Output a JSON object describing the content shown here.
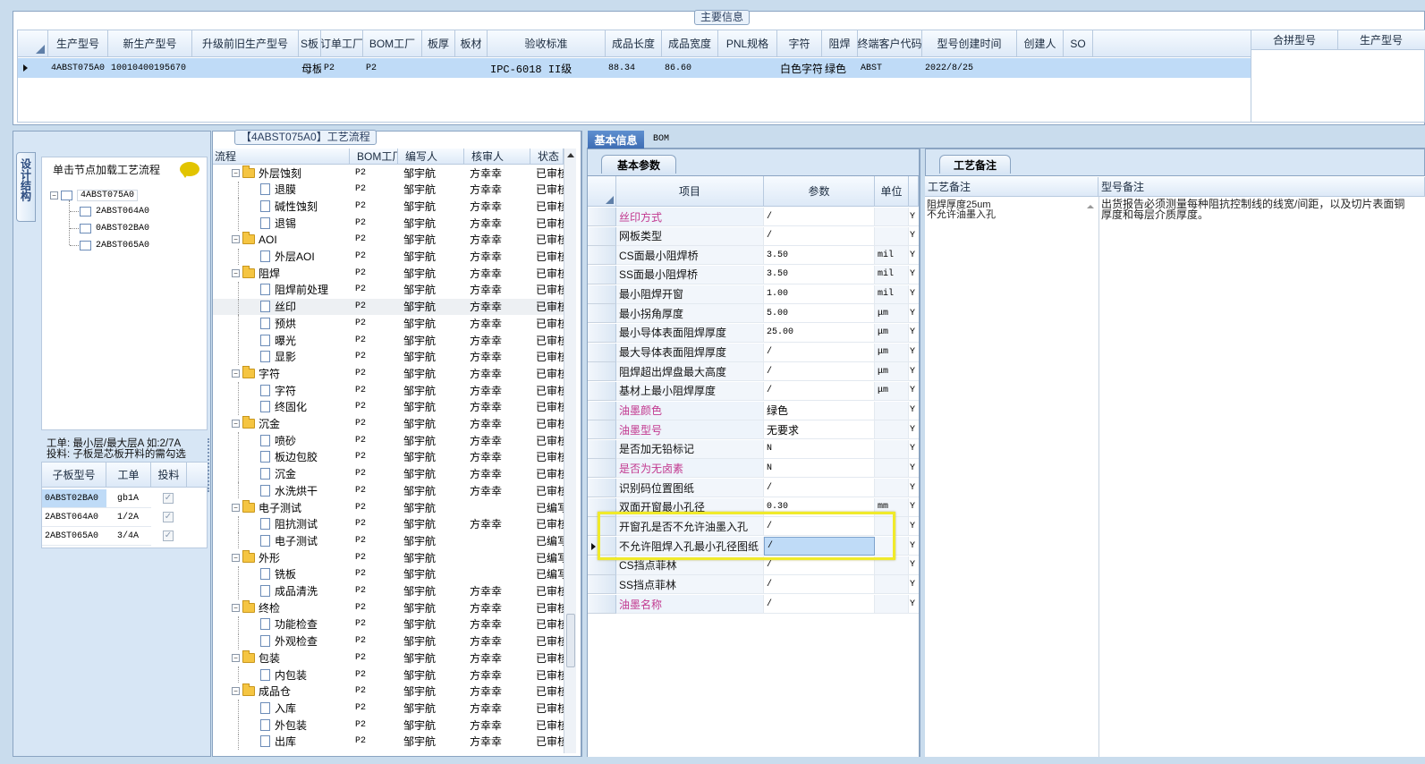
{
  "top": {
    "group_title": "主要信息",
    "columns": [
      "生产型号",
      "新生产型号",
      "升级前旧生产型号",
      "S板",
      "订单工厂",
      "BOM工厂",
      "板厚",
      "板材",
      "验收标准",
      "成品长度",
      "成品宽度",
      "PNL规格",
      "字符",
      "阻焊",
      "终端客户代码",
      "型号创建时间",
      "创建人",
      "SO"
    ],
    "row": [
      "4ABST075A0",
      "10010400195670",
      "",
      "母板",
      "P2",
      "P2",
      "",
      "",
      "IPC-6018 II级",
      "88.34",
      "86.60",
      "",
      "白色字符",
      "绿色",
      "ABST",
      "2022/8/25",
      "",
      ""
    ],
    "right_columns": [
      "合拼型号",
      "生产型号"
    ]
  },
  "left": {
    "vertical_tab": "设计结构",
    "hint": "单击节点加载工艺流程",
    "tree_root": "4ABST075A0",
    "tree_children": [
      "2ABST064A0",
      "0ABST02BA0",
      "2ABST065A0"
    ],
    "note_line1": "工单: 最小层/最大层A 如:2/7A",
    "note_line2": "投料: 子板是芯板开料的需勾选",
    "sub_columns": [
      "子板型号",
      "工单",
      "投料"
    ],
    "sub_rows": [
      {
        "model": "0ABST02BA0",
        "order": "gb1A",
        "check": "✓"
      },
      {
        "model": "2ABST064A0",
        "order": "1/2A",
        "check": "✓"
      },
      {
        "model": "2ABST065A0",
        "order": "3/4A",
        "check": "✓"
      }
    ]
  },
  "flow": {
    "title": "【4ABST075A0】工艺流程",
    "columns": [
      "流程",
      "BOM工厂",
      "编写人",
      "核审人",
      "状态"
    ],
    "rows": [
      {
        "name": "外层蚀刻",
        "folder": true,
        "bom": "P2",
        "writer": "邹宇航",
        "reviewer": "方幸幸",
        "status": "已审核"
      },
      {
        "name": "退膜",
        "folder": false,
        "bom": "P2",
        "writer": "邹宇航",
        "reviewer": "方幸幸",
        "status": "已审核"
      },
      {
        "name": "碱性蚀刻",
        "folder": false,
        "bom": "P2",
        "writer": "邹宇航",
        "reviewer": "方幸幸",
        "status": "已审核"
      },
      {
        "name": "退锡",
        "folder": false,
        "bom": "P2",
        "writer": "邹宇航",
        "reviewer": "方幸幸",
        "status": "已审核"
      },
      {
        "name": "AOI",
        "folder": true,
        "bom": "P2",
        "writer": "邹宇航",
        "reviewer": "方幸幸",
        "status": "已审核"
      },
      {
        "name": "外层AOI",
        "folder": false,
        "bom": "P2",
        "writer": "邹宇航",
        "reviewer": "方幸幸",
        "status": "已审核"
      },
      {
        "name": "阻焊",
        "folder": true,
        "bom": "P2",
        "writer": "邹宇航",
        "reviewer": "方幸幸",
        "status": "已审核"
      },
      {
        "name": "阻焊前处理",
        "folder": false,
        "bom": "P2",
        "writer": "邹宇航",
        "reviewer": "方幸幸",
        "status": "已审核"
      },
      {
        "name": "丝印",
        "folder": false,
        "bom": "P2",
        "writer": "邹宇航",
        "reviewer": "方幸幸",
        "status": "已审核"
      },
      {
        "name": "预烘",
        "folder": false,
        "bom": "P2",
        "writer": "邹宇航",
        "reviewer": "方幸幸",
        "status": "已审核"
      },
      {
        "name": "曝光",
        "folder": false,
        "bom": "P2",
        "writer": "邹宇航",
        "reviewer": "方幸幸",
        "status": "已审核"
      },
      {
        "name": "显影",
        "folder": false,
        "bom": "P2",
        "writer": "邹宇航",
        "reviewer": "方幸幸",
        "status": "已审核"
      },
      {
        "name": "字符",
        "folder": true,
        "bom": "P2",
        "writer": "邹宇航",
        "reviewer": "方幸幸",
        "status": "已审核"
      },
      {
        "name": "字符",
        "folder": false,
        "bom": "P2",
        "writer": "邹宇航",
        "reviewer": "方幸幸",
        "status": "已审核"
      },
      {
        "name": "终固化",
        "folder": false,
        "bom": "P2",
        "writer": "邹宇航",
        "reviewer": "方幸幸",
        "status": "已审核"
      },
      {
        "name": "沉金",
        "folder": true,
        "bom": "P2",
        "writer": "邹宇航",
        "reviewer": "方幸幸",
        "status": "已审核"
      },
      {
        "name": "喷砂",
        "folder": false,
        "bom": "P2",
        "writer": "邹宇航",
        "reviewer": "方幸幸",
        "status": "已审核"
      },
      {
        "name": "板边包胶",
        "folder": false,
        "bom": "P2",
        "writer": "邹宇航",
        "reviewer": "方幸幸",
        "status": "已审核"
      },
      {
        "name": "沉金",
        "folder": false,
        "bom": "P2",
        "writer": "邹宇航",
        "reviewer": "方幸幸",
        "status": "已审核"
      },
      {
        "name": "水洗烘干",
        "folder": false,
        "bom": "P2",
        "writer": "邹宇航",
        "reviewer": "方幸幸",
        "status": "已审核"
      },
      {
        "name": "电子测试",
        "folder": true,
        "bom": "P2",
        "writer": "邹宇航",
        "reviewer": "",
        "status": "已编写"
      },
      {
        "name": "阻抗测试",
        "folder": false,
        "bom": "P2",
        "writer": "邹宇航",
        "reviewer": "方幸幸",
        "status": "已审核"
      },
      {
        "name": "电子测试",
        "folder": false,
        "bom": "P2",
        "writer": "邹宇航",
        "reviewer": "",
        "status": "已编写"
      },
      {
        "name": "外形",
        "folder": true,
        "bom": "P2",
        "writer": "邹宇航",
        "reviewer": "",
        "status": "已编写"
      },
      {
        "name": "铣板",
        "folder": false,
        "bom": "P2",
        "writer": "邹宇航",
        "reviewer": "",
        "status": "已编写"
      },
      {
        "name": "成品清洗",
        "folder": false,
        "bom": "P2",
        "writer": "邹宇航",
        "reviewer": "方幸幸",
        "status": "已审核"
      },
      {
        "name": "终检",
        "folder": true,
        "bom": "P2",
        "writer": "邹宇航",
        "reviewer": "方幸幸",
        "status": "已审核"
      },
      {
        "name": "功能检查",
        "folder": false,
        "bom": "P2",
        "writer": "邹宇航",
        "reviewer": "方幸幸",
        "status": "已审核"
      },
      {
        "name": "外观检查",
        "folder": false,
        "bom": "P2",
        "writer": "邹宇航",
        "reviewer": "方幸幸",
        "status": "已审核"
      },
      {
        "name": "包装",
        "folder": true,
        "bom": "P2",
        "writer": "邹宇航",
        "reviewer": "方幸幸",
        "status": "已审核"
      },
      {
        "name": "内包装",
        "folder": false,
        "bom": "P2",
        "writer": "邹宇航",
        "reviewer": "方幸幸",
        "status": "已审核"
      },
      {
        "name": "成品仓",
        "folder": true,
        "bom": "P2",
        "writer": "邹宇航",
        "reviewer": "方幸幸",
        "status": "已审核"
      },
      {
        "name": "入库",
        "folder": false,
        "bom": "P2",
        "writer": "邹宇航",
        "reviewer": "方幸幸",
        "status": "已审核"
      },
      {
        "name": "外包装",
        "folder": false,
        "bom": "P2",
        "writer": "邹宇航",
        "reviewer": "方幸幸",
        "status": "已审核"
      },
      {
        "name": "出库",
        "folder": false,
        "bom": "P2",
        "writer": "邹宇航",
        "reviewer": "方幸幸",
        "status": "已审核"
      }
    ]
  },
  "info": {
    "tabs": [
      "基本信息",
      "BOM"
    ],
    "subtab": "基本参数",
    "columns": [
      "项目",
      "参数",
      "单位"
    ],
    "rows": [
      {
        "item": "丝印方式",
        "pink": true,
        "param": "/",
        "unit": "",
        "flag": "Y"
      },
      {
        "item": "网板类型",
        "pink": false,
        "param": "/",
        "unit": "",
        "flag": "Y"
      },
      {
        "item": "CS面最小阻焊桥",
        "pink": false,
        "param": "3.50",
        "unit": "mil",
        "flag": "Y"
      },
      {
        "item": "SS面最小阻焊桥",
        "pink": false,
        "param": "3.50",
        "unit": "mil",
        "flag": "Y"
      },
      {
        "item": "最小阻焊开窗",
        "pink": false,
        "param": "1.00",
        "unit": "mil",
        "flag": "Y"
      },
      {
        "item": "最小拐角厚度",
        "pink": false,
        "param": "5.00",
        "unit": "μm",
        "flag": "Y"
      },
      {
        "item": "最小导体表面阻焊厚度",
        "pink": false,
        "param": "25.00",
        "unit": "μm",
        "flag": "Y"
      },
      {
        "item": "最大导体表面阻焊厚度",
        "pink": false,
        "param": "/",
        "unit": "μm",
        "flag": "Y"
      },
      {
        "item": "阻焊超出焊盘最大高度",
        "pink": false,
        "param": "/",
        "unit": "μm",
        "flag": "Y"
      },
      {
        "item": "基材上最小阻焊厚度",
        "pink": false,
        "param": "/",
        "unit": "μm",
        "flag": "Y"
      },
      {
        "item": "油墨颜色",
        "pink": true,
        "param": "绿色",
        "unit": "",
        "flag": "Y"
      },
      {
        "item": "油墨型号",
        "pink": true,
        "param": "无要求",
        "unit": "",
        "flag": "Y"
      },
      {
        "item": "是否加无铅标记",
        "pink": false,
        "param": "N",
        "unit": "",
        "flag": "Y"
      },
      {
        "item": "是否为无卤素",
        "pink": true,
        "param": "N",
        "unit": "",
        "flag": "Y"
      },
      {
        "item": "识别码位置图纸",
        "pink": false,
        "param": "/",
        "unit": "",
        "flag": "Y"
      },
      {
        "item": "双面开窗最小孔径",
        "pink": false,
        "param": "0.30",
        "unit": "mm",
        "flag": "Y"
      },
      {
        "item": "开窗孔是否不允许油墨入孔",
        "pink": false,
        "param": "/",
        "unit": "",
        "flag": "Y"
      },
      {
        "item": "不允许阻焊入孔最小孔径图纸",
        "pink": false,
        "param": "/",
        "unit": "",
        "flag": "Y"
      },
      {
        "item": "CS挡点菲林",
        "pink": false,
        "param": "/",
        "unit": "",
        "flag": "Y"
      },
      {
        "item": "SS挡点菲林",
        "pink": false,
        "param": "/",
        "unit": "",
        "flag": "Y"
      },
      {
        "item": "油墨名称",
        "pink": true,
        "param": "/",
        "unit": "",
        "flag": "Y"
      }
    ]
  },
  "remarks": {
    "tab": "工艺备注",
    "col1": "工艺备注",
    "col2": "型号备注",
    "note1_line1": "阻焊厚度25um",
    "note1_line2": "不允许油墨入孔",
    "note2_line1": "出货报告必须测量每种阻抗控制线的线宽/间距，以及切片表面铜",
    "note2_line2": "厚度和每层介质厚度。"
  },
  "colors": {
    "selection": "#bfdbf7",
    "highlight_box": "#f0ea2a",
    "pink_label": "#c2388f",
    "header_tab": "#3e6db4"
  }
}
